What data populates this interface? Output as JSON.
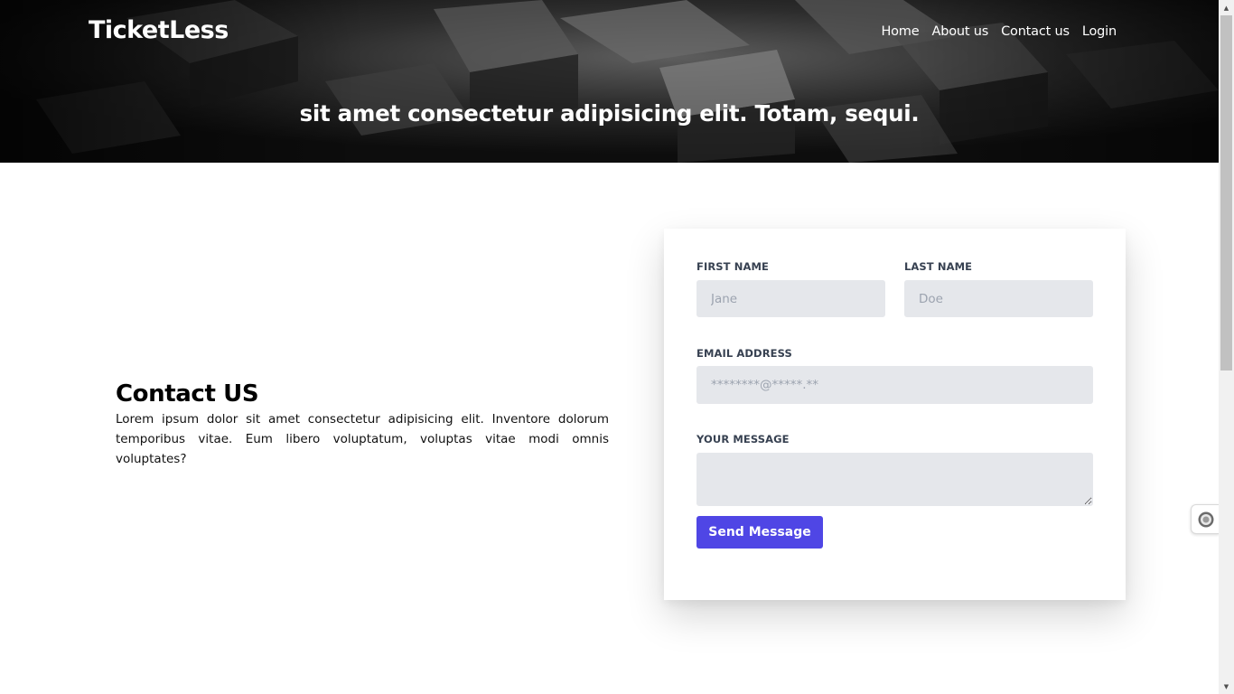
{
  "brand": "TicketLess",
  "nav": [
    "Home",
    "About us",
    "Contact us",
    "Login"
  ],
  "hero": {
    "tagline": "sit amet consectetur adipisicing elit. Totam, sequi."
  },
  "contact": {
    "heading": "Contact US",
    "text": "Lorem ipsum dolor sit amet consectetur adipisicing elit. Inventore dolorum temporibus vitae. Eum libero voluptatum, voluptas vitae modi omnis voluptates?"
  },
  "form": {
    "first_name": {
      "label": "FIRST NAME",
      "placeholder": "Jane",
      "value": ""
    },
    "last_name": {
      "label": "LAST NAME",
      "placeholder": "Doe",
      "value": ""
    },
    "email": {
      "label": "EMAIL ADDRESS",
      "placeholder": "********@*****.**",
      "value": ""
    },
    "message": {
      "label": "YOUR MESSAGE",
      "placeholder": "",
      "value": ""
    },
    "submit_label": "Send Message"
  },
  "icons": {
    "side_widget": "accessibility-widget-icon"
  },
  "colors": {
    "accent": "#4f46e5",
    "input_bg": "#e5e7eb",
    "hero_bg": "#121212"
  }
}
